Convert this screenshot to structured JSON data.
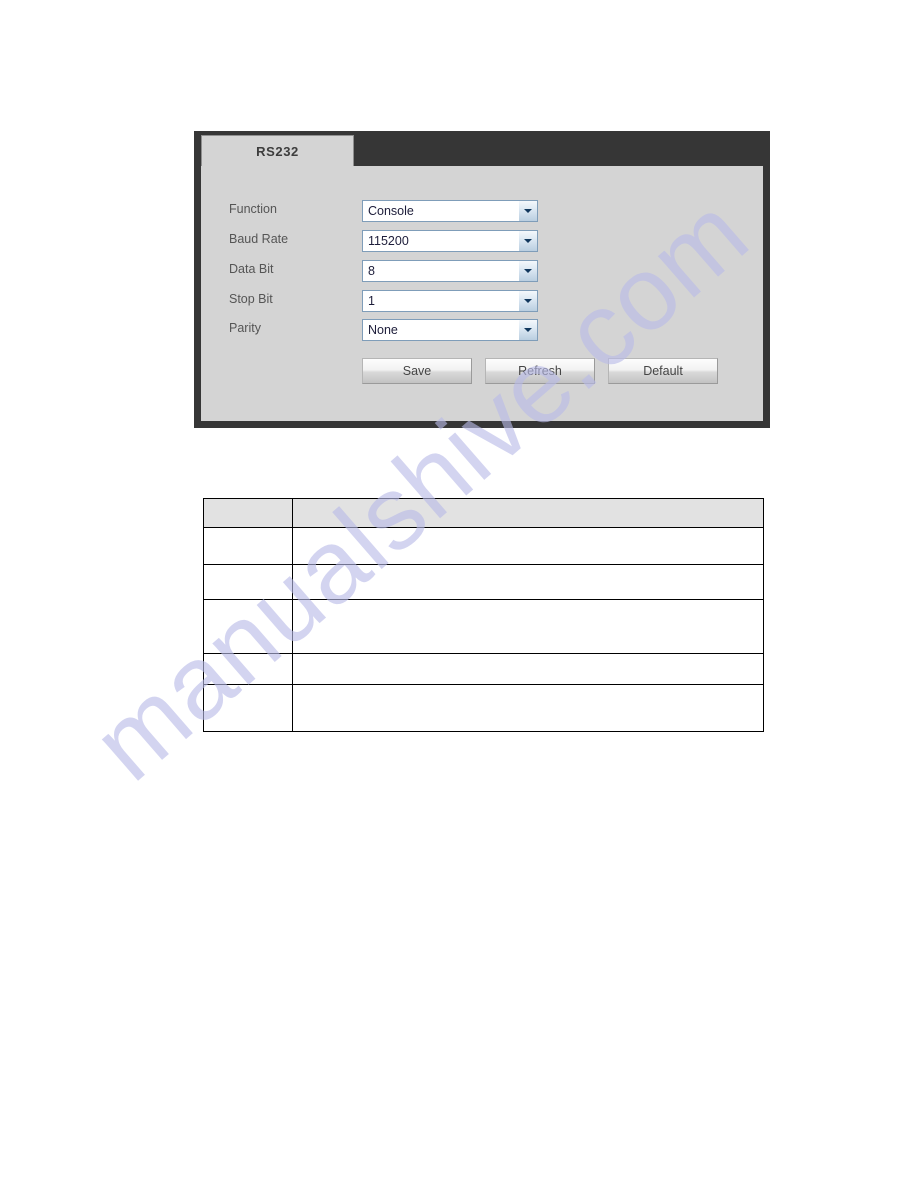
{
  "panel": {
    "tab_label": "RS232",
    "fields": [
      {
        "label": "Function",
        "value": "Console",
        "name": "function"
      },
      {
        "label": "Baud Rate",
        "value": "115200",
        "name": "baud-rate"
      },
      {
        "label": "Data Bit",
        "value": "8",
        "name": "data-bit"
      },
      {
        "label": "Stop Bit",
        "value": "1",
        "name": "stop-bit"
      },
      {
        "label": "Parity",
        "value": "None",
        "name": "parity"
      }
    ],
    "buttons": {
      "save": "Save",
      "refresh": "Refresh",
      "default": "Default"
    },
    "colors": {
      "header_dark": "#363636",
      "body_gray": "#d4d4d4",
      "input_border": "#7f9db9",
      "label_text": "#555555"
    }
  },
  "table": {
    "header": {
      "parameter": "",
      "function": ""
    },
    "rows": [
      {
        "parameter": "",
        "function": ""
      },
      {
        "parameter": "",
        "function": ""
      },
      {
        "parameter": "",
        "function": ""
      },
      {
        "parameter": "",
        "function": ""
      },
      {
        "parameter": "",
        "function": ""
      }
    ]
  },
  "watermark": {
    "text": "manualshive.com",
    "color": "#b9bbe8"
  }
}
